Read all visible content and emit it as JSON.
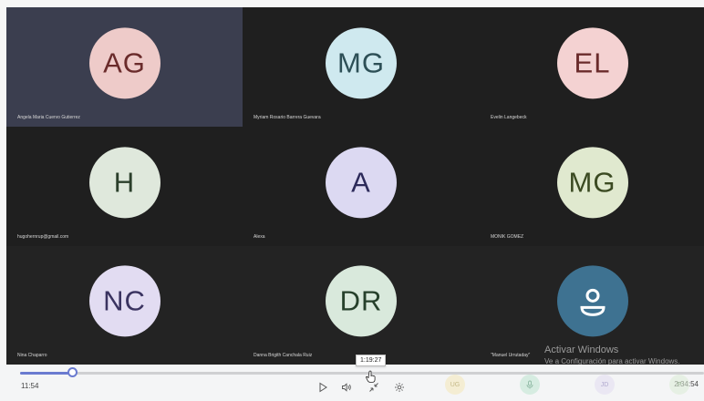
{
  "participants": [
    {
      "initials": "AG",
      "name": "Angela Maria Cuervo Gutierrez",
      "bg": "#eecbc9",
      "fg": "#6a2b2b"
    },
    {
      "initials": "MG",
      "name": "Myriam Rosario Barrera Guevara",
      "bg": "#cfe9ef",
      "fg": "#2d4f56"
    },
    {
      "initials": "EL",
      "name": "Evelin  Langebeck",
      "bg": "#f4d2d2",
      "fg": "#6a2b2b"
    },
    {
      "initials": "H",
      "name": "hugohernrup@gmail.com",
      "bg": "#dfe8dc",
      "fg": "#2b3f2b"
    },
    {
      "initials": "A",
      "name": "Alexa",
      "bg": "#dcd9f2",
      "fg": "#2c2a5a"
    },
    {
      "initials": "MG",
      "name": "MONIK GOMEZ",
      "bg": "#e0e9cf",
      "fg": "#3b4a22"
    },
    {
      "initials": "NC",
      "name": "Nina Chaparro",
      "bg": "#e2dcf2",
      "fg": "#3a3360"
    },
    {
      "initials": "DR",
      "name": "Danna Brigith Canchala Ruiz",
      "bg": "#d9e9dc",
      "fg": "#26402b"
    },
    {
      "initials": "",
      "name": "\"Manuel Urrutaday\"",
      "bg": "#3e7291",
      "fg": "#ffffff",
      "icon": "person-icon"
    }
  ],
  "watermark": {
    "line1": "Activar Windows",
    "line2": "Ve a Configuración para activar Windows."
  },
  "player": {
    "progress_fraction": 0.077,
    "current_time": "11:54",
    "total_time": "2:34:54",
    "hover_time": "1:19:27"
  },
  "controls": [
    "play-icon",
    "volume-icon",
    "exit-fullscreen-icon",
    "settings-icon"
  ],
  "filmstrip": [
    {
      "initials": "UG",
      "bg": "#f4e7b8",
      "fg": "#a08a30"
    },
    {
      "initials": "",
      "bg": "#bfe6d1",
      "fg": "#3f8a63",
      "icon": "microphone-icon"
    },
    {
      "initials": "JD",
      "bg": "#e2dcf2",
      "fg": "#7a6cb0"
    },
    {
      "initials": "P",
      "bg": "#dcecd6",
      "fg": "#4f7a45"
    }
  ]
}
